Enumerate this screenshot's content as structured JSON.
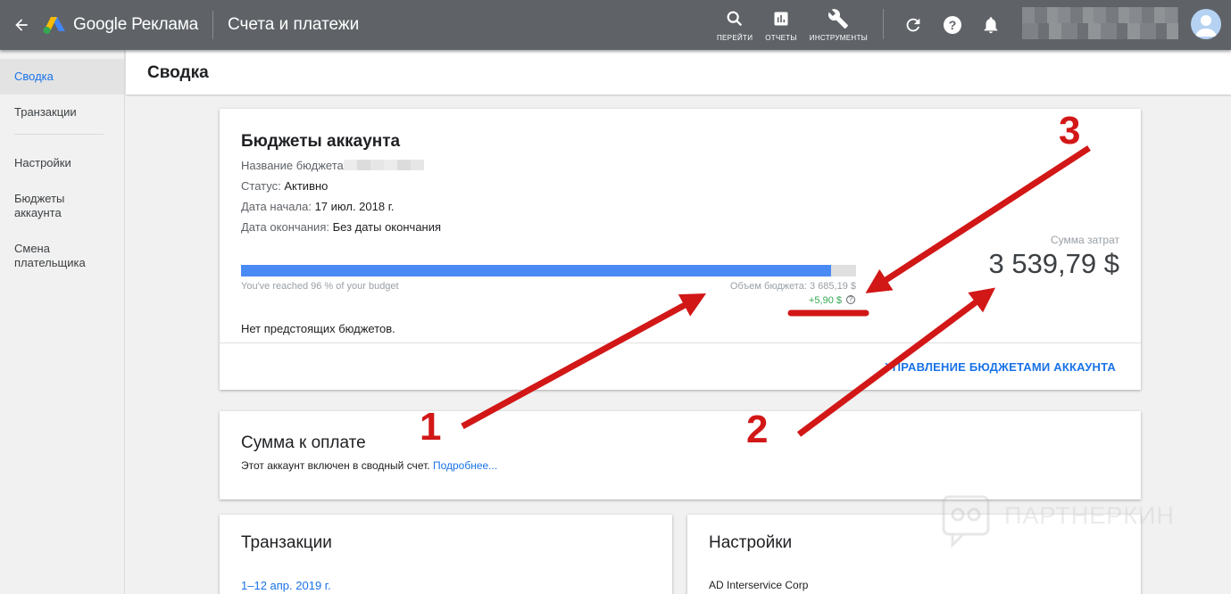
{
  "header": {
    "product_name": "Google Реклама",
    "page_name": "Счета и платежи",
    "tools": [
      {
        "label": "ПЕРЕЙТИ",
        "icon": "search-icon"
      },
      {
        "label": "ОТЧЕТЫ",
        "icon": "reports-icon"
      },
      {
        "label": "ИНСТРУМЕНТЫ",
        "icon": "wrench-icon"
      }
    ]
  },
  "sidebar": {
    "items": [
      {
        "label": "Сводка",
        "active": true
      },
      {
        "label": "Транзакции"
      },
      {
        "label": "Настройки"
      },
      {
        "label": "Бюджеты аккаунта"
      },
      {
        "label": "Смена плательщика"
      }
    ]
  },
  "page": {
    "title": "Сводка"
  },
  "budgets_card": {
    "title": "Бюджеты аккаунта",
    "name_label": "Название бюджета",
    "status_label": "Статус:",
    "status_value": "Активно",
    "start_label": "Дата начала:",
    "start_value": "17 июл. 2018 г.",
    "end_label": "Дата окончания:",
    "end_value": "Без даты окончания",
    "progress_percent": 96,
    "progress_text": "You've reached 96 % of your budget",
    "budget_amount_text": "Объем бюджета: 3 685,19 $",
    "budget_delta_text": "+5,90 $",
    "spend_label": "Сумма затрат",
    "spend_value": "3 539,79 $",
    "no_upcoming_text": "Нет предстоящих бюджетов.",
    "manage_link": "УПРАВЛЕНИЕ БЮДЖЕТАМИ АККАУНТА"
  },
  "payment_card": {
    "title": "Сумма к оплате",
    "text": "Этот аккаунт включен в сводный счет.",
    "link": "Подробнее..."
  },
  "transactions_card": {
    "title": "Транзакции",
    "date_range": "1–12 апр. 2019 г."
  },
  "settings_card": {
    "title": "Настройки",
    "company": "AD Interservice Corp"
  },
  "annotations": {
    "arrow_1": "1",
    "arrow_2": "2",
    "arrow_3": "3",
    "arrow_color": "#d21717"
  },
  "watermark": {
    "text": "ПАРТНЕРКИН"
  },
  "colors": {
    "topbar": "#5f6368",
    "accent": "#1a73e8",
    "progress": "#4a8af4"
  }
}
